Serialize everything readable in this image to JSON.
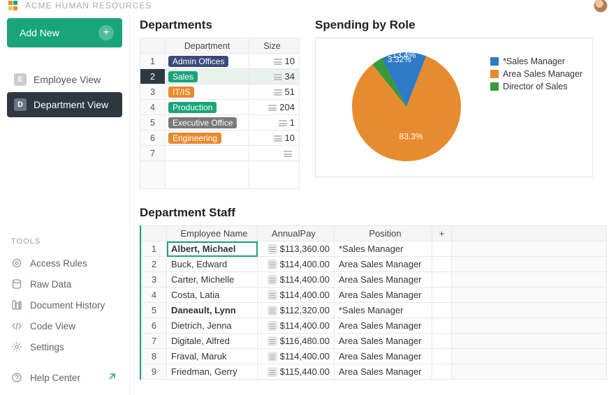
{
  "app_title": "ACME HUMAN RESOURCES",
  "add_new_label": "Add New",
  "nav": {
    "employee": {
      "badge": "E",
      "label": "Employee View"
    },
    "department": {
      "badge": "D",
      "label": "Department View"
    }
  },
  "tools_header": "TOOLS",
  "tools": {
    "access": "Access Rules",
    "raw": "Raw Data",
    "history": "Document History",
    "code": "Code View",
    "settings": "Settings",
    "help": "Help Center"
  },
  "sections": {
    "departments": "Departments",
    "spending": "Spending by Role",
    "staff": "Department Staff"
  },
  "dept_headers": {
    "name": "Department",
    "size": "Size"
  },
  "departments": [
    {
      "name": "Admin Offices",
      "size": "10",
      "color": "#3a4a7a"
    },
    {
      "name": "Sales",
      "size": "34",
      "color": "#1aa47a",
      "selected": true
    },
    {
      "name": "IT/IS",
      "size": "51",
      "color": "#e78b2f"
    },
    {
      "name": "Production",
      "size": "204",
      "color": "#1aa47a"
    },
    {
      "name": "Executive Office",
      "size": "1",
      "color": "#7a7a7a"
    },
    {
      "name": "Engineering",
      "size": "10",
      "color": "#e78b2f"
    }
  ],
  "chart_data": {
    "type": "pie",
    "title": "Spending by Role",
    "series": [
      {
        "name": "*Sales Manager",
        "value": 13.4,
        "label": "13.4%",
        "color": "#2f7ac6"
      },
      {
        "name": "Area Sales Manager",
        "value": 83.3,
        "label": "83.3%",
        "color": "#e78b2f"
      },
      {
        "name": "Director of Sales",
        "value": 3.32,
        "label": "3.32%",
        "color": "#3a9a3a"
      }
    ]
  },
  "staff_headers": {
    "name": "Employee Name",
    "pay": "AnnualPay",
    "pos": "Position"
  },
  "staff": [
    {
      "name": "Albert, Michael",
      "pay": "$113,360.00",
      "pos": "*Sales Manager",
      "selected": true,
      "bold": true
    },
    {
      "name": "Buck, Edward",
      "pay": "$114,400.00",
      "pos": "Area Sales Manager"
    },
    {
      "name": "Carter, Michelle",
      "pay": "$114,400.00",
      "pos": "Area Sales Manager"
    },
    {
      "name": "Costa, Latia",
      "pay": "$114,400.00",
      "pos": "Area Sales Manager"
    },
    {
      "name": "Daneault, Lynn",
      "pay": "$112,320.00",
      "pos": "*Sales Manager",
      "bold": true
    },
    {
      "name": "Dietrich, Jenna",
      "pay": "$114,400.00",
      "pos": "Area Sales Manager"
    },
    {
      "name": "Digitale, Alfred",
      "pay": "$116,480.00",
      "pos": "Area Sales Manager"
    },
    {
      "name": "Fraval, Maruk",
      "pay": "$114,400.00",
      "pos": "Area Sales Manager"
    },
    {
      "name": "Friedman, Gerry",
      "pay": "$115,440.00",
      "pos": "Area Sales Manager"
    }
  ],
  "add_col_label": "+"
}
